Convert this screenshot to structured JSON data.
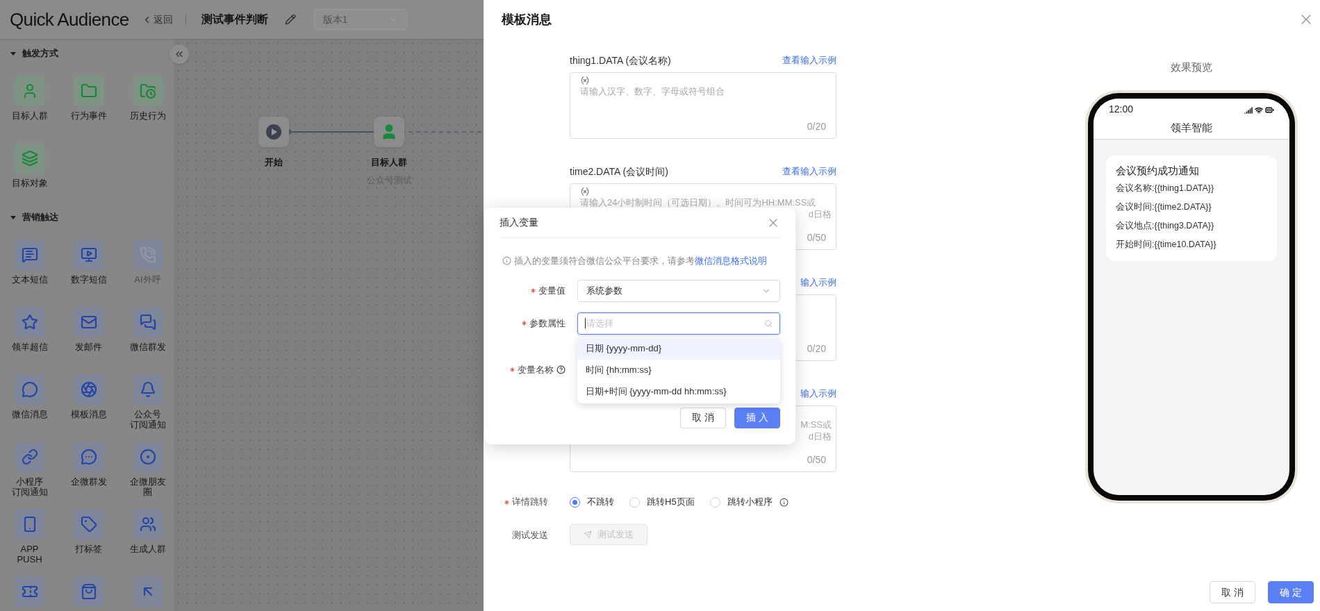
{
  "app": {
    "logo": "Quick Audience",
    "back": "返回",
    "title": "测试事件判断",
    "version": {
      "value": "版本1",
      "disabled": true
    }
  },
  "sidebar": {
    "sections": [
      {
        "title": "触发方式",
        "expanded": true,
        "items": [
          {
            "label": "目标人群",
            "disabled": false
          },
          {
            "label": "行为事件",
            "disabled": false
          },
          {
            "label": "历史行为",
            "disabled": false
          },
          {
            "label": "目标对象",
            "disabled": false
          }
        ]
      },
      {
        "title": "营销触达",
        "expanded": true,
        "items": [
          {
            "label": "文本短信",
            "disabled": false
          },
          {
            "label": "数字短信",
            "disabled": false
          },
          {
            "label": "AI外呼",
            "disabled": true
          },
          {
            "label": "领羊超信",
            "disabled": false
          },
          {
            "label": "发邮件",
            "disabled": false
          },
          {
            "label": "微信群发",
            "disabled": false
          },
          {
            "label": "微信消息",
            "disabled": false
          },
          {
            "label": "模板消息",
            "disabled": false
          },
          {
            "lines": [
              "公众号",
              "订阅通知"
            ],
            "disabled": false
          },
          {
            "lines": [
              "小程序",
              "订阅通知"
            ],
            "disabled": false
          },
          {
            "label": "企微群发",
            "disabled": false
          },
          {
            "lines": [
              "企微朋友",
              "圈"
            ],
            "disabled": false
          },
          {
            "lines": [
              "APP",
              "PUSH"
            ],
            "disabled": false
          },
          {
            "label": "打标签",
            "disabled": false
          },
          {
            "label": "生成人群",
            "disabled": false
          },
          {
            "disabled": false
          },
          {
            "disabled": false
          },
          {
            "disabled": false
          }
        ]
      }
    ]
  },
  "canvas": {
    "nodes": [
      {
        "kind": "start",
        "label": "开始"
      },
      {
        "kind": "audience",
        "label": "目标人群",
        "subtitle": "公众号测试"
      }
    ]
  },
  "drawer": {
    "title": "模板消息",
    "fields": [
      {
        "label": "thing1.DATA (会议名称)",
        "link": "查看输入示例",
        "icon": true,
        "lines": [
          {
            "kind": "full",
            "text": "请输入汉字、数字、字母或符号组合"
          }
        ],
        "count": "0/20"
      },
      {
        "label": "time2.DATA (会议时间)",
        "link": "查看输入示例",
        "icon": true,
        "lines": [
          {
            "kind": "full",
            "text": "请输入24小时制时间（可选日期）。时间可为HH:MM:SS或"
          },
          {
            "kind": "tail",
            "text": "d日格"
          }
        ],
        "count": "0/50"
      },
      {
        "link": "输入示例",
        "count": "0/20"
      },
      {
        "link": "输入示例",
        "lines": [
          {
            "kind": "tail",
            "text": "M:SS或"
          },
          {
            "kind": "tail",
            "text": "d日格"
          }
        ],
        "count": "0/50"
      }
    ],
    "jump": {
      "label": "详情跳转",
      "required": true,
      "options": [
        {
          "label": "不跳转",
          "selected": true
        },
        {
          "label": "跳转H5页面",
          "selected": false
        },
        {
          "label": "跳转小程序",
          "selected": false,
          "info": true
        }
      ]
    },
    "test_send": {
      "label": "测试发送",
      "button": "测试发送",
      "disabled": true
    },
    "buttons": [
      {
        "kind": "secondary",
        "label": "取消"
      },
      {
        "kind": "primary",
        "label": "确定"
      }
    ]
  },
  "preview": {
    "title": "效果预览",
    "time": "12:00",
    "app_name": "领羊智能",
    "card_title": "会议预约成功通知",
    "lines": [
      "会议名称:{{thing1.DATA}}",
      "会议时间:{{time2.DATA}}",
      "会议地点:{{thing3.DATA}}",
      "开始时间:{{time10.DATA}}"
    ]
  },
  "dialog": {
    "title": "插入变量",
    "notice": "插入的变量须符合微信公众平台要求，请参考",
    "notice_link": "微信消息格式说明",
    "rows": [
      {
        "kind": "select",
        "label": "变量值",
        "required": true,
        "value": "系统参数"
      },
      {
        "kind": "search",
        "label": "参数属性",
        "required": true,
        "placeholder": "请选择",
        "focused": true
      },
      {
        "kind": "covered",
        "label": "变量名称",
        "required": true,
        "help": true
      }
    ],
    "options": [
      {
        "label": "日期 {yyyy-mm-dd}",
        "selected": true
      },
      {
        "label": "时间 {hh:mm:ss}",
        "selected": false
      },
      {
        "label": "日期+时间 {yyyy-mm-dd hh:mm:ss}",
        "selected": false
      }
    ],
    "buttons": [
      {
        "kind": "secondary",
        "label": "取消"
      },
      {
        "kind": "primary",
        "label": "插入"
      }
    ]
  }
}
